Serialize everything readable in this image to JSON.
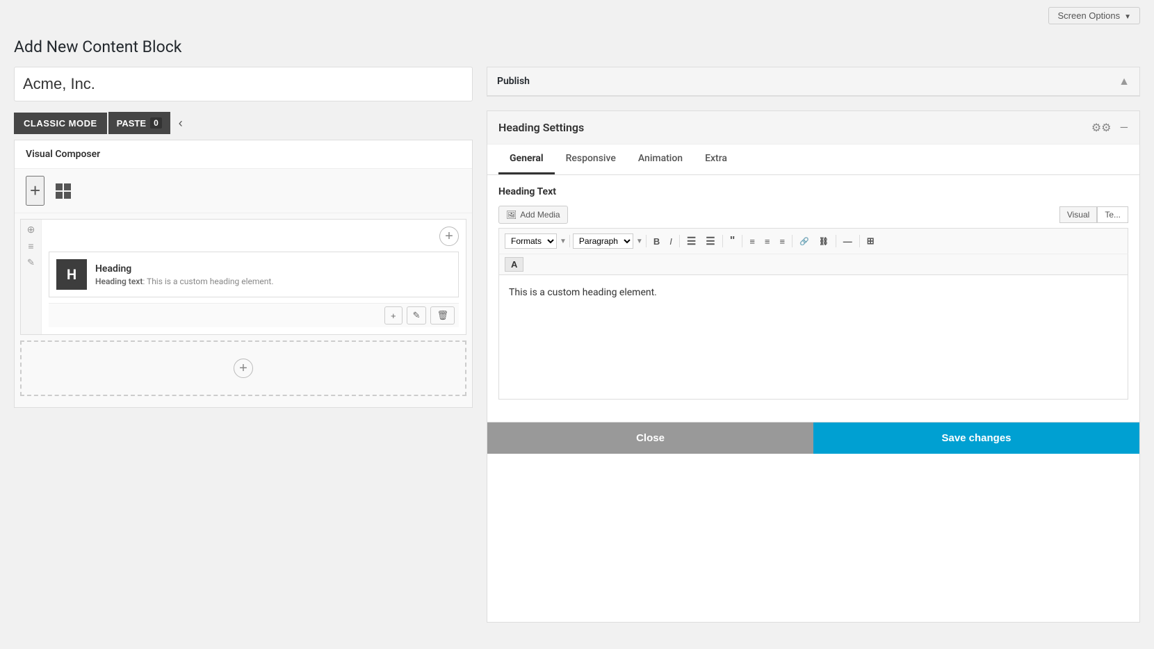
{
  "top": {
    "screen_options_label": "Screen Options"
  },
  "page": {
    "title": "Add New Content Block"
  },
  "editor": {
    "title_placeholder": "Acme, Inc.",
    "title_value": "Acme, Inc."
  },
  "toolbar": {
    "classic_mode_label": "CLASSIC MODE",
    "paste_label": "PASTE",
    "paste_count": "0"
  },
  "visual_composer": {
    "label": "Visual Composer"
  },
  "heading_block": {
    "icon_letter": "H",
    "title": "Heading",
    "preview_label": "Heading text",
    "preview_value": "This is a custom heading element."
  },
  "publish_panel": {
    "title": "Publish"
  },
  "settings_panel": {
    "title": "Heading Settings",
    "tabs": [
      "General",
      "Responsive",
      "Animation",
      "Extra"
    ],
    "active_tab": "General",
    "section_title": "Heading Text",
    "add_media_label": "Add Media",
    "view_visual": "Visual",
    "view_text": "Te...",
    "editor_content": "This is a custom heading element.",
    "formats_label": "Formats",
    "paragraph_label": "Paragraph",
    "close_label": "Close",
    "save_label": "Save changes"
  }
}
